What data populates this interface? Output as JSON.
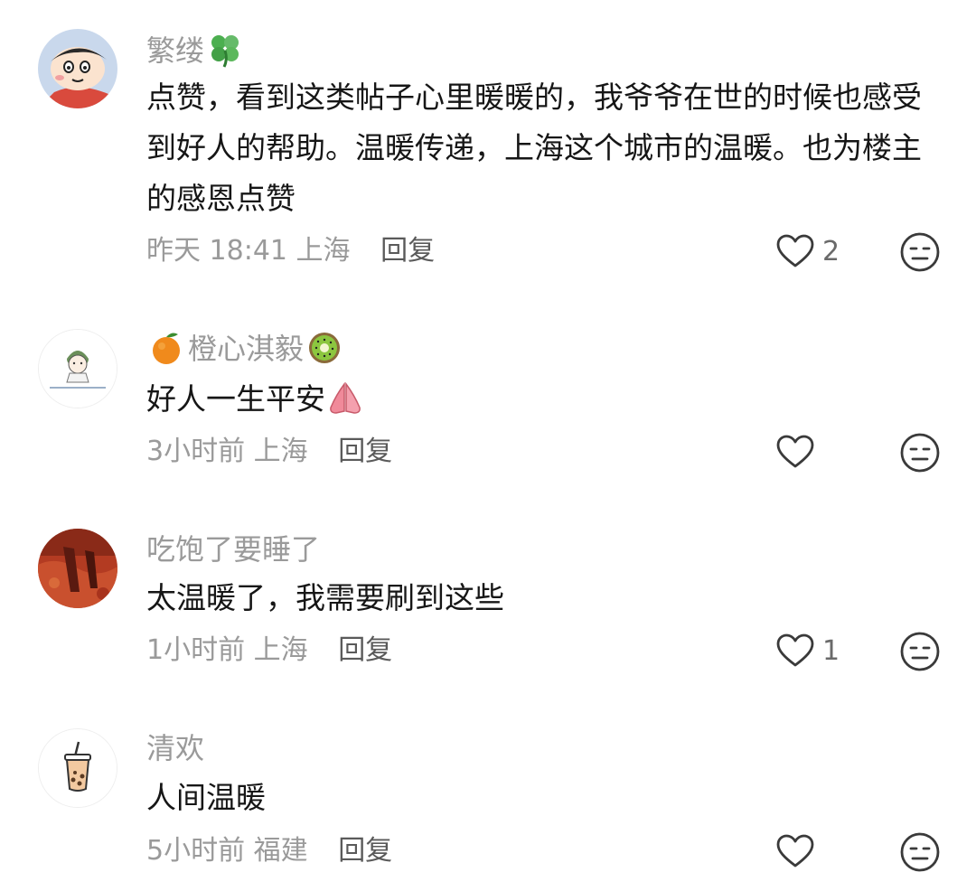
{
  "comments": [
    {
      "username": "繁缕",
      "name_emoji": "four-leaf-clover",
      "text": "点赞，看到这类帖子心里暖暖的，我爷爷在世的时候也感受到好人的帮助。温暖传递，上海这个城市的温暖。也为楼主的感恩点赞",
      "time": "昨天 18:41",
      "location": "上海",
      "reply_label": "回复",
      "likes": "2",
      "avatar": "cartoon-boy-avatar"
    },
    {
      "username": "橙心淇毅",
      "name_emoji_left": "orange",
      "name_emoji_right": "kiwi",
      "text": "好人一生平安",
      "text_emoji": "praying-hands",
      "time": "3小时前",
      "location": "上海",
      "reply_label": "回复",
      "likes": "",
      "avatar": "drawn-girl-avatar"
    },
    {
      "username": "吃饱了要睡了",
      "text": "太温暖了，我需要刷到这些",
      "time": "1小时前",
      "location": "上海",
      "reply_label": "回复",
      "likes": "1",
      "avatar": "red-landscape-avatar"
    },
    {
      "username": "清欢",
      "text": "人间温暖",
      "time": "5小时前",
      "location": "福建",
      "reply_label": "回复",
      "likes": "",
      "avatar": "bubble-tea-avatar"
    }
  ],
  "colors": {
    "meta_text": "#9a9a9a",
    "body_text": "#161616",
    "icon_stroke": "#3a3a3a"
  }
}
